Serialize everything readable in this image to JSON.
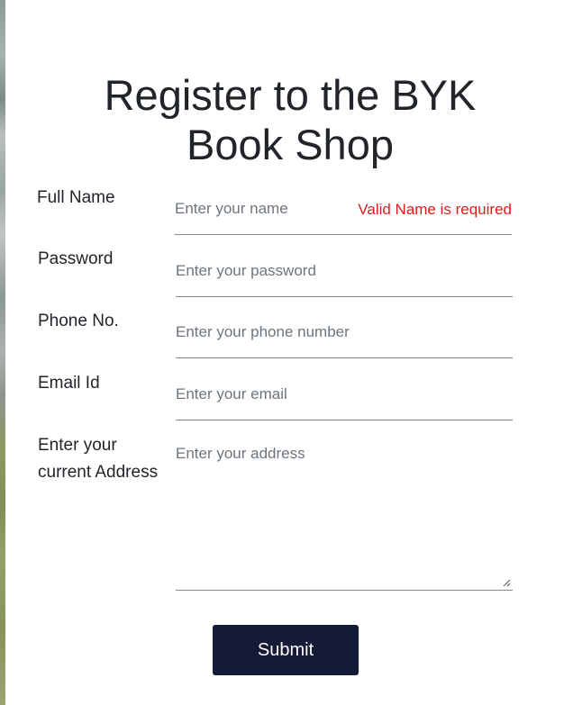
{
  "form": {
    "title_line1": "Register to the BYK",
    "title_line2": "Book Shop",
    "fields": [
      {
        "label": "Full Name",
        "placeholder": "Enter your name",
        "error": "Valid Name is required"
      },
      {
        "label": "Password",
        "placeholder": "Enter your password"
      },
      {
        "label": "Phone No.",
        "placeholder": "Enter your phone number"
      },
      {
        "label": "Email Id",
        "placeholder": "Enter your email"
      }
    ],
    "address": {
      "label_line1": "Enter your",
      "label_line2": "current Address",
      "placeholder": "Enter your address"
    },
    "submit_label": "Submit"
  },
  "colors": {
    "button_bg": "#151a36",
    "error_text": "#e01b1b",
    "title_text": "#212529",
    "placeholder_text": "#6c757d"
  }
}
